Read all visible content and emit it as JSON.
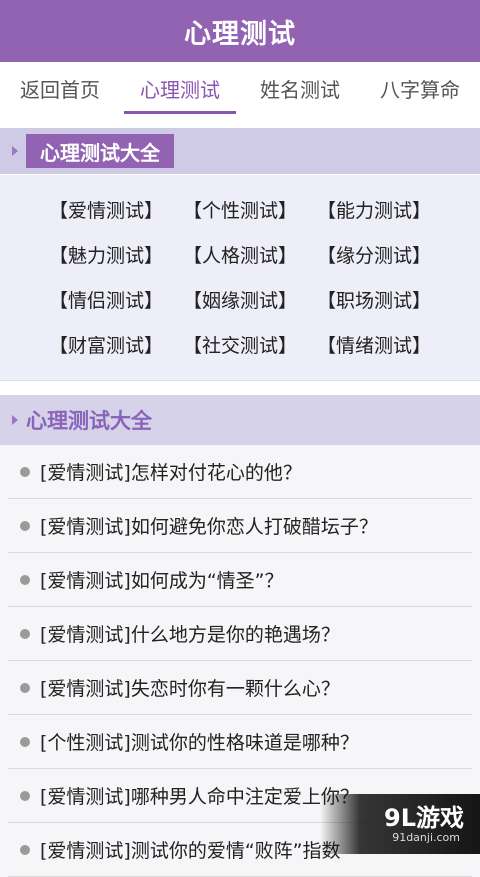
{
  "header": {
    "title": "心理测试"
  },
  "tabs": [
    {
      "label": "返回首页"
    },
    {
      "label": "心理测试"
    },
    {
      "label": "姓名测试"
    },
    {
      "label": "八字算命"
    }
  ],
  "active_tab": 1,
  "categories_section": {
    "title": "心理测试大全",
    "rows": [
      [
        "【爱情测试】",
        "【个性测试】",
        "【能力测试】"
      ],
      [
        "【魅力测试】",
        "【人格测试】",
        "【缘分测试】"
      ],
      [
        "【情侣测试】",
        "【姻缘测试】",
        "【职场测试】"
      ],
      [
        "【财富测试】",
        "【社交测试】",
        "【情绪测试】"
      ]
    ]
  },
  "list_section": {
    "title": "心理测试大全",
    "items": [
      "[爱情测试]怎样对付花心的他？",
      "[爱情测试]如何避免你恋人打破醋坛子？",
      "[爱情测试]如何成为“情圣”？",
      "[爱情测试]什么地方是你的艳遇场？",
      "[爱情测试]失恋时你有一颗什么心？",
      "[个性测试]测试你的性格味道是哪种？",
      "[爱情测试]哪种男人命中注定爱上你？",
      "[爱情测试]测试你的爱情“败阵”指数"
    ]
  },
  "watermark": {
    "main": "9L游戏",
    "sub": "91danji.com"
  },
  "colors": {
    "brand": "#9263b3",
    "section_bg": "#cfcbe6",
    "panel_bg": "#eeeef9"
  }
}
